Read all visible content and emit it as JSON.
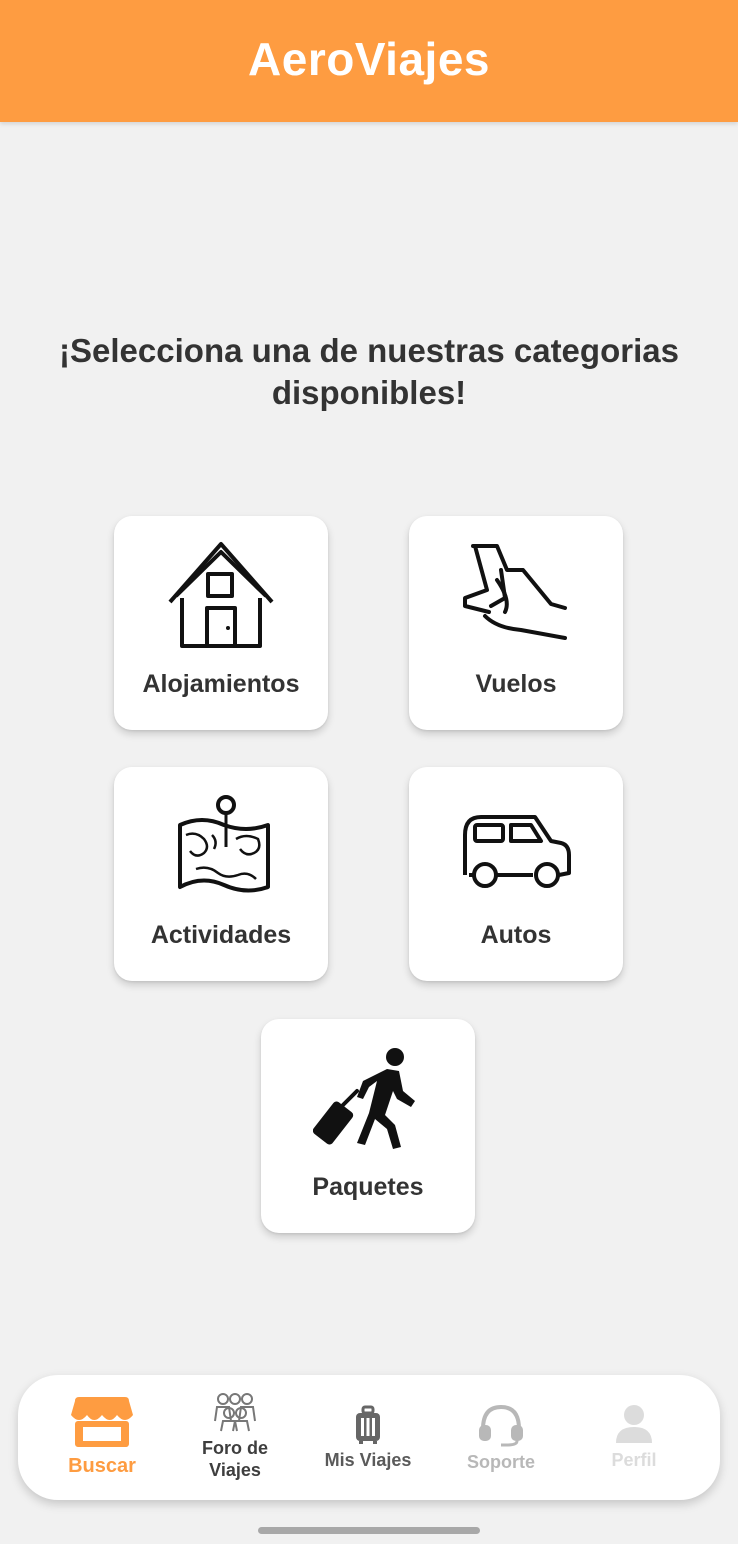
{
  "app_bar": {
    "title": "AeroViajes"
  },
  "main": {
    "headline": "¡Selecciona una de nuestras categorias disponibles!",
    "categories": [
      {
        "label": "Alojamientos",
        "icon": "house-icon"
      },
      {
        "label": "Vuelos",
        "icon": "airplane-seat-icon"
      },
      {
        "label": "Actividades",
        "icon": "map-icon"
      },
      {
        "label": "Autos",
        "icon": "car-icon"
      },
      {
        "label": "Paquetes",
        "icon": "traveler-with-suitcase-icon"
      }
    ]
  },
  "bottom_nav": {
    "items": [
      {
        "label": "Buscar",
        "icon": "store-icon",
        "active": true
      },
      {
        "label": "Foro de\nViajes",
        "icon": "group-icon",
        "active": false
      },
      {
        "label": "Mis Viajes",
        "icon": "luggage-icon",
        "active": false
      },
      {
        "label": "Soporte",
        "icon": "headset-icon",
        "active": false
      },
      {
        "label": "Perfil",
        "icon": "person-icon",
        "active": false
      }
    ]
  },
  "colors": {
    "primary": "#fe9c41",
    "background": "#f1f1f1",
    "card": "#ffffff",
    "text": "#333333",
    "nav_inactive": "#5a5a5a",
    "nav_disabled": "#b8b8b8",
    "nav_faded": "#dcdcdc"
  }
}
